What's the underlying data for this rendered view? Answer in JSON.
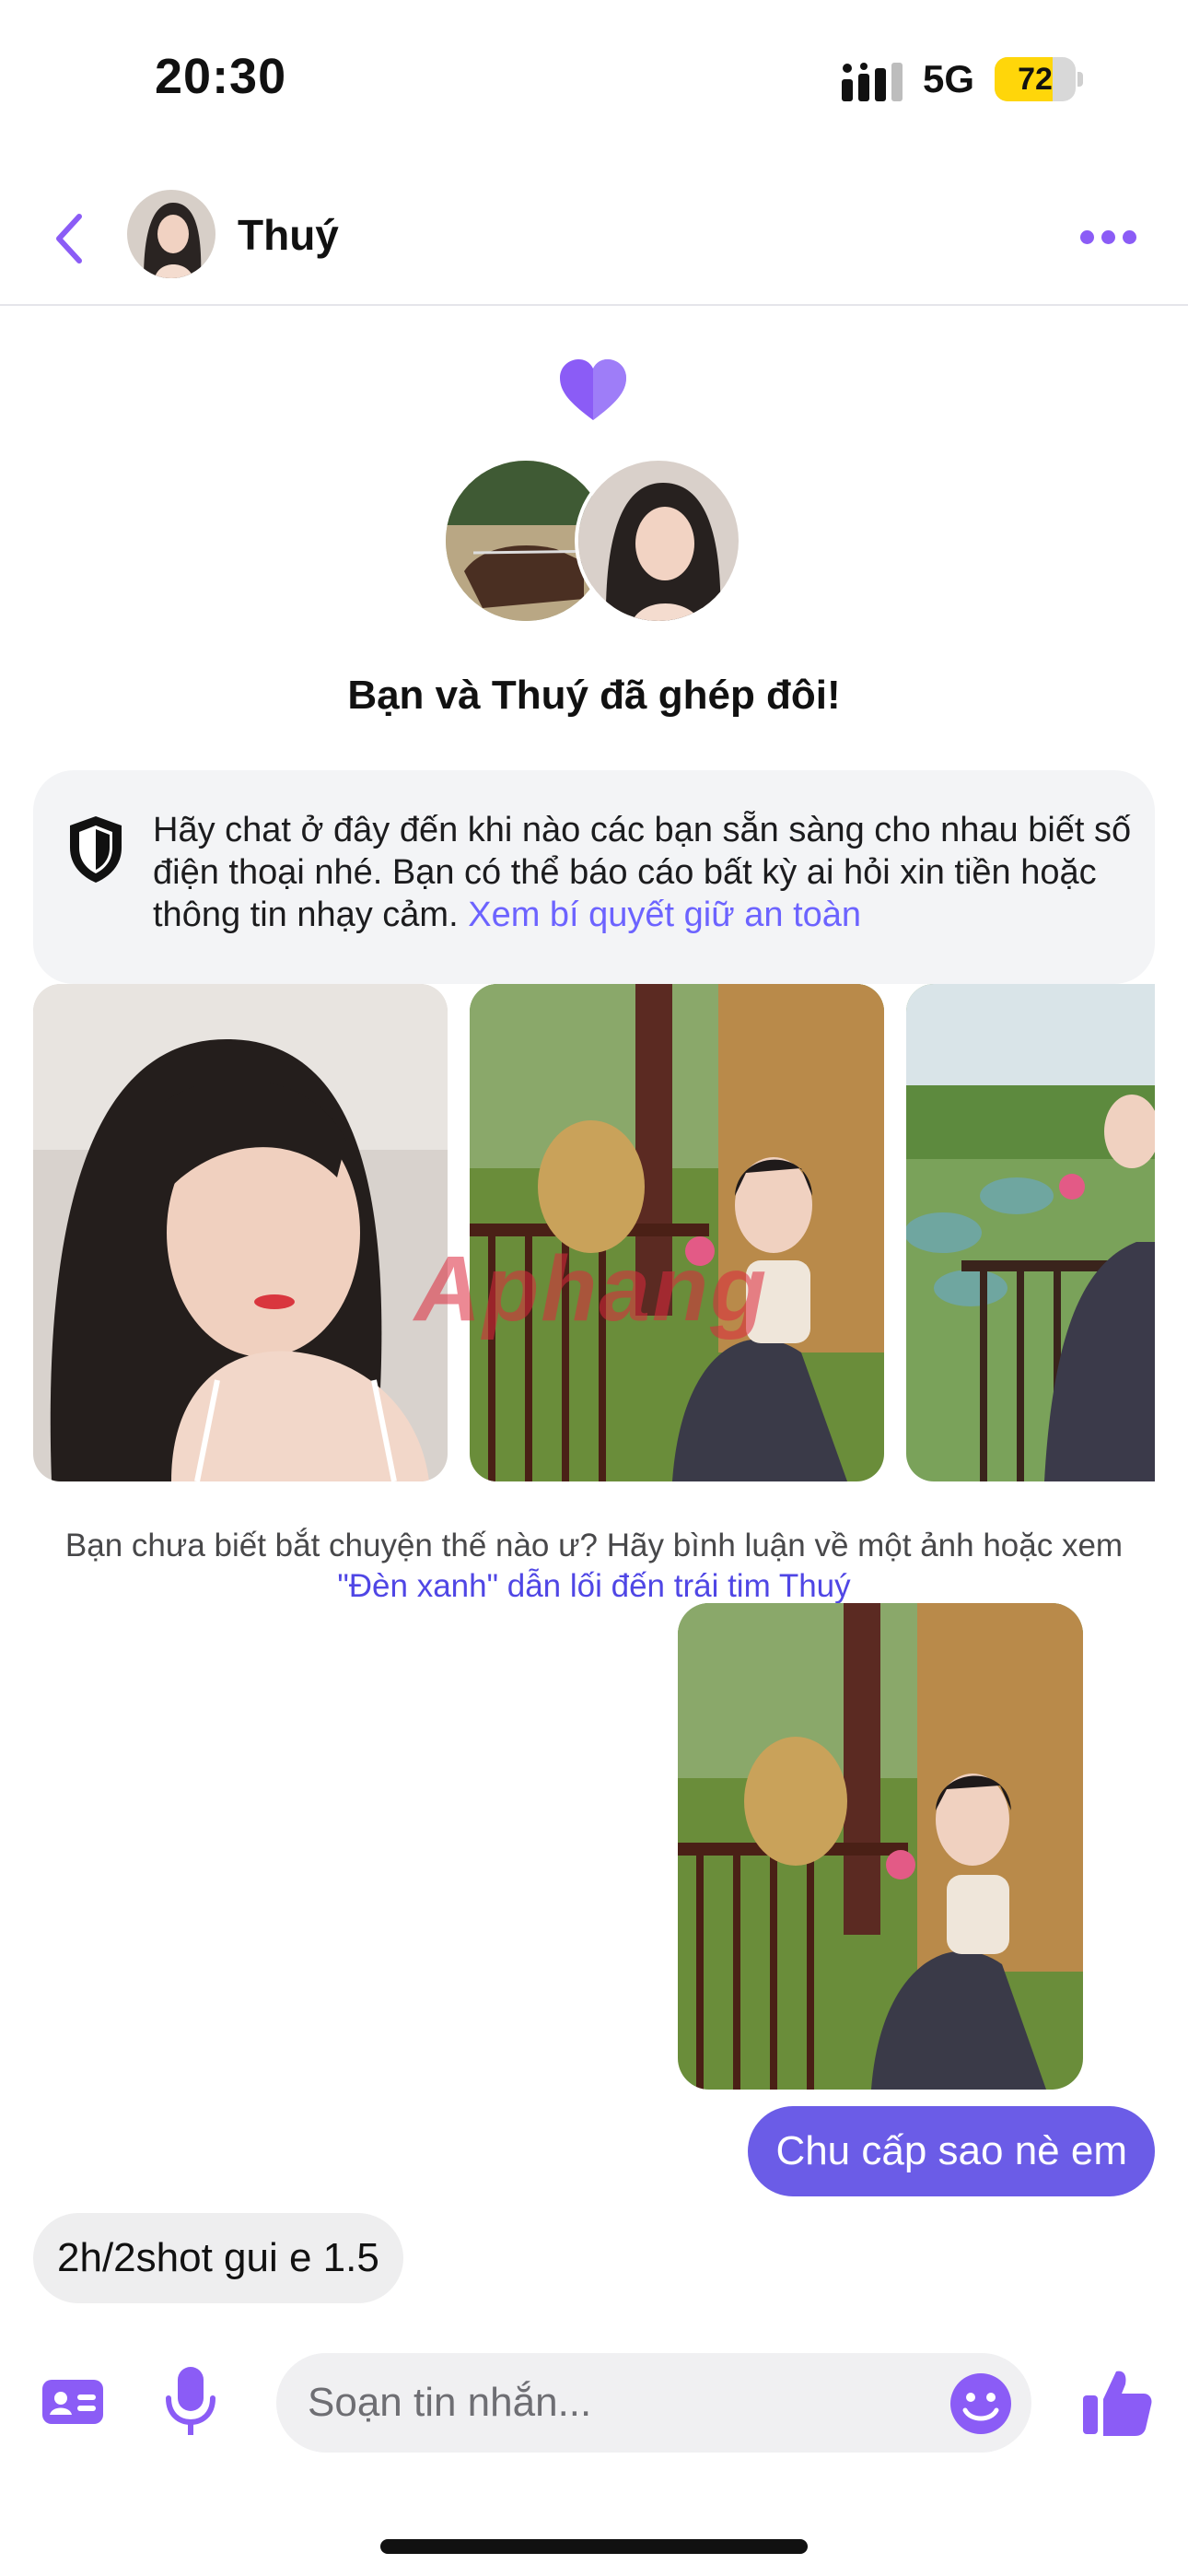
{
  "status_bar": {
    "time": "20:30",
    "network": "5G",
    "battery": "72",
    "battery_level": 0.72
  },
  "header": {
    "contact_name": "Thuý"
  },
  "match": {
    "title": "Bạn và Thuý đã ghép đôi!"
  },
  "safety": {
    "text": "Hãy chat ở đây đến khi nào các bạn sẵn sàng cho nhau biết số điện thoại nhé. Bạn có thể báo cáo bất kỳ ai hỏi xin tiền hoặc thông tin nhạy cảm. ",
    "link": "Xem bí quyết giữ an toàn"
  },
  "watermark": "Aphang",
  "prompt": {
    "text": "Bạn chưa biết bắt chuyện thế nào ư? Hãy bình luận về một ảnh hoặc xem ",
    "link": "\"Đèn xanh\" dẫn lối đến trái tim Thuý"
  },
  "messages": {
    "outgoing": "Chu cấp sao nè em",
    "incoming": "2h/2shot gui e 1.5"
  },
  "composer": {
    "placeholder": "Soạn tin nhắn..."
  },
  "colors": {
    "accent": "#8b5cf6",
    "outgoing_bubble": "#6b5ce7",
    "link": "#6c63ff"
  },
  "icons": [
    "signal-icon",
    "chevron-left-icon",
    "more-icon",
    "heart-icon",
    "shield-icon",
    "profile-card-icon",
    "microphone-icon",
    "emoji-icon",
    "thumbs-up-icon"
  ]
}
